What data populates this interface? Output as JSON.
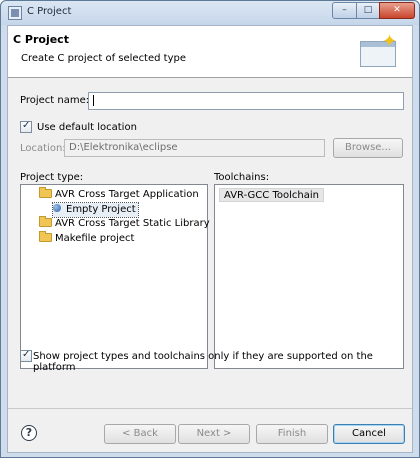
{
  "window": {
    "title": "C Project",
    "minimize_glyph": "–",
    "maximize_glyph": "□",
    "close_glyph": "✕"
  },
  "header": {
    "title": "C Project",
    "description": "Create C project of selected type",
    "icon": "new-project-wizard-icon"
  },
  "form": {
    "project_name_label": "Project name:",
    "project_name_value": "",
    "use_default_location_label": "Use default location",
    "use_default_location_checked": true,
    "location_label": "Location:",
    "location_value": "D:\\Elektronika\\eclipse",
    "browse_label": "Browse..."
  },
  "project_type": {
    "label": "Project type:",
    "items": [
      {
        "label": "AVR Cross Target Application",
        "icon": "folder-icon"
      },
      {
        "label": "Empty Project",
        "icon": "project-type-icon",
        "selected": true
      },
      {
        "label": "AVR Cross Target Static Library",
        "icon": "folder-icon"
      },
      {
        "label": "Makefile project",
        "icon": "folder-icon"
      }
    ]
  },
  "toolchains": {
    "label": "Toolchains:",
    "items": [
      {
        "label": "AVR-GCC Toolchain"
      }
    ]
  },
  "filter": {
    "label": "Show project types and toolchains only if they are supported on the platform",
    "checked": true
  },
  "buttons": {
    "help_glyph": "?",
    "back": "< Back",
    "next": "Next >",
    "finish": "Finish",
    "cancel": "Cancel"
  }
}
